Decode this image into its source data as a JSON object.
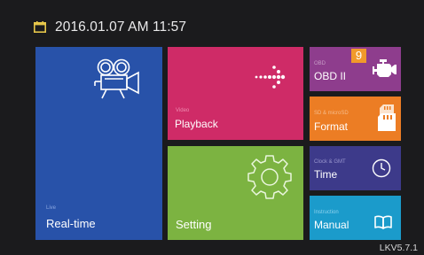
{
  "header": {
    "datetime": "2016.01.07   AM 11:57",
    "icon": "calendar-icon"
  },
  "tiles": {
    "live": {
      "caption": "Live",
      "label": "Real-time",
      "icon": "movie-camera-icon"
    },
    "video": {
      "caption": "Video",
      "label": "Playback",
      "icon": "dotted-arrow-icon"
    },
    "setting": {
      "caption": "",
      "label": "Setting",
      "icon": "gear-icon"
    },
    "obd": {
      "caption": "OBD",
      "label": "OBD II",
      "badge": "9",
      "icon": "engine-icon"
    },
    "format": {
      "caption": "SD & microSD",
      "label": "Format",
      "icon": "sd-card-icon"
    },
    "time": {
      "caption": "Clock & GMT",
      "label": "Time",
      "icon": "clock-icon"
    },
    "manual": {
      "caption": "Instruction",
      "label": "Manual",
      "icon": "book-icon"
    }
  },
  "footer": {
    "version": "LKV5.7.1"
  },
  "colors": {
    "background": "#1b1b1d",
    "live": "#2852a9",
    "video": "#cf2b67",
    "setting": "#7cb341",
    "obd": "#8e3d8d",
    "format": "#ec7d24",
    "time": "#3d3a8a",
    "manual": "#1b9bcb",
    "badge": "#f19a2b"
  }
}
